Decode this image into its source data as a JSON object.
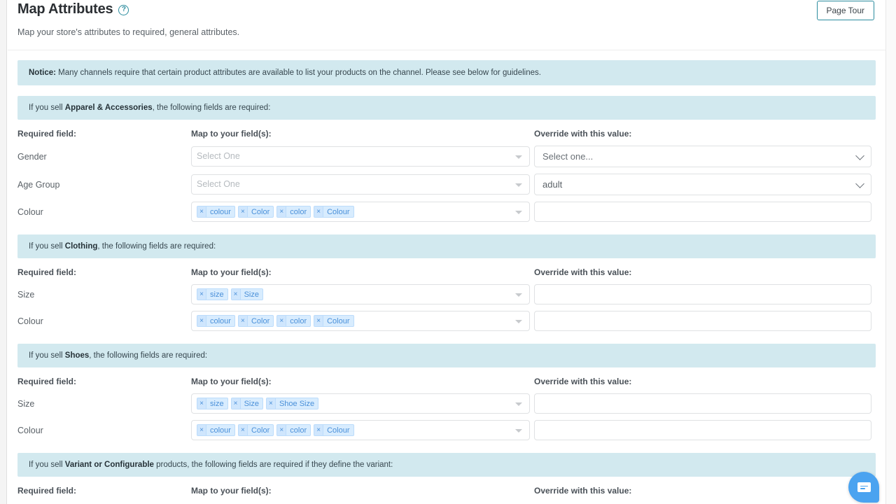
{
  "header": {
    "title": "Map Attributes",
    "help_icon": "help-circle-icon",
    "subtitle": "Map your store's attributes to required, general attributes.",
    "page_tour_label": "Page Tour"
  },
  "notice": {
    "label": "Notice:",
    "text": " Many channels require that certain product attributes are available to list your products on the channel. Please see below for guidelines."
  },
  "columns": {
    "required_field": "Required field:",
    "map_to": "Map to your field(s):",
    "override": "Override with this value:"
  },
  "placeholders": {
    "multiselect": "Select One",
    "select_one": "Select one...",
    "text_input": ""
  },
  "sections": [
    {
      "banner_prefix": "If you sell ",
      "banner_strong": "Apparel & Accessories",
      "banner_suffix": ", the following fields are required:",
      "rows": [
        {
          "label": "Gender",
          "map_type": "placeholder",
          "map_placeholder": "Select One",
          "chips": [],
          "override_type": "select",
          "override_value": "Select one...",
          "override_is_placeholder": true
        },
        {
          "label": "Age Group",
          "map_type": "placeholder",
          "map_placeholder": "Select One",
          "chips": [],
          "override_type": "select",
          "override_value": "adult",
          "override_is_placeholder": false
        },
        {
          "label": "Colour",
          "map_type": "chips",
          "map_placeholder": "",
          "chips": [
            "colour",
            "Color",
            "color",
            "Colour"
          ],
          "override_type": "text",
          "override_value": "",
          "override_is_placeholder": false
        }
      ]
    },
    {
      "banner_prefix": "If you sell ",
      "banner_strong": "Clothing",
      "banner_suffix": ", the following fields are required:",
      "rows": [
        {
          "label": "Size",
          "map_type": "chips",
          "map_placeholder": "",
          "chips": [
            "size",
            "Size"
          ],
          "override_type": "text",
          "override_value": "",
          "override_is_placeholder": false
        },
        {
          "label": "Colour",
          "map_type": "chips",
          "map_placeholder": "",
          "chips": [
            "colour",
            "Color",
            "color",
            "Colour"
          ],
          "override_type": "text",
          "override_value": "",
          "override_is_placeholder": false
        }
      ]
    },
    {
      "banner_prefix": "If you sell ",
      "banner_strong": "Shoes",
      "banner_suffix": ", the following fields are required:",
      "rows": [
        {
          "label": "Size",
          "map_type": "chips",
          "map_placeholder": "",
          "chips": [
            "size",
            "Size",
            "Shoe Size"
          ],
          "override_type": "text",
          "override_value": "",
          "override_is_placeholder": false
        },
        {
          "label": "Colour",
          "map_type": "chips",
          "map_placeholder": "",
          "chips": [
            "colour",
            "Color",
            "color",
            "Colour"
          ],
          "override_type": "text",
          "override_value": "",
          "override_is_placeholder": false
        }
      ]
    },
    {
      "banner_prefix": "If you sell ",
      "banner_strong": "Variant or Configurable",
      "banner_suffix": " products, the following fields are required if they define the variant:",
      "rows": []
    }
  ],
  "chat": {
    "icon": "chat-bubble-icon"
  },
  "colors": {
    "banner_bg": "#d2e9ef",
    "accent_teal": "#2b8c9e",
    "chip_bg": "#d8ecfe",
    "chip_text": "#4a90d9",
    "chat_blue": "#4aa3f0"
  }
}
